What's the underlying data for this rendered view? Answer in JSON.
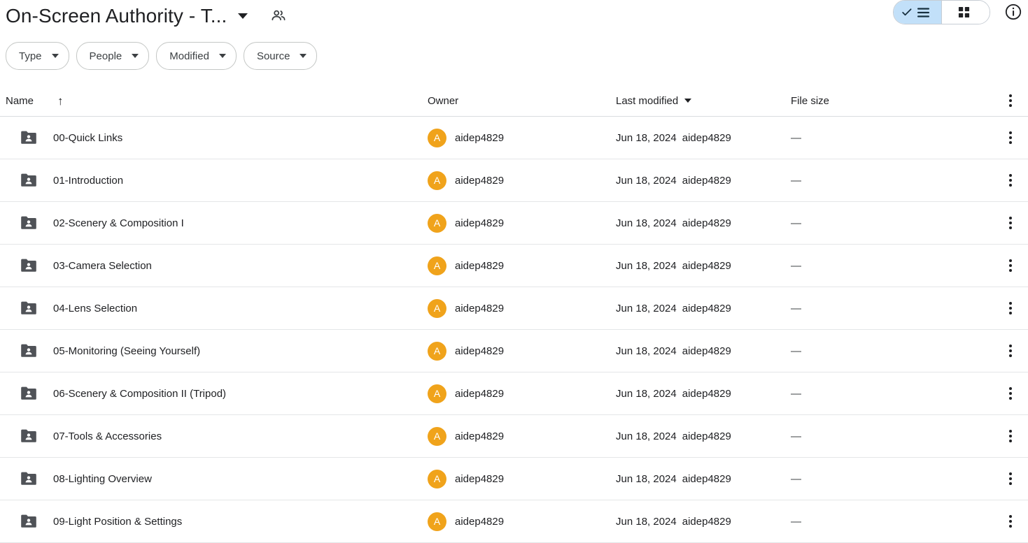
{
  "header": {
    "title": "On-Screen Authority - T...",
    "title_caret_icon": "chevron-down-icon",
    "people_icon": "people-icon",
    "view_list_label": "",
    "view_grid_label": "",
    "info_icon": "info-icon",
    "list_view_icon": "list-view-icon",
    "grid_view_icon": "grid-view-icon",
    "list_view_selected": true,
    "accent_selected_bg": "#c2e0f9"
  },
  "filters": [
    {
      "label": "Type"
    },
    {
      "label": "People"
    },
    {
      "label": "Modified"
    },
    {
      "label": "Source"
    }
  ],
  "table": {
    "columns": {
      "name": "Name",
      "sort_arrow": "↑",
      "owner": "Owner",
      "last_modified": "Last modified",
      "file_size": "File size"
    },
    "rows": [
      {
        "name": "00-Quick Links",
        "owner": "aidep4829",
        "avatar_letter": "A",
        "modified_date": "Jun 18, 2024",
        "modified_by": "aidep4829",
        "size": "—"
      },
      {
        "name": "01-Introduction",
        "owner": "aidep4829",
        "avatar_letter": "A",
        "modified_date": "Jun 18, 2024",
        "modified_by": "aidep4829",
        "size": "—"
      },
      {
        "name": "02-Scenery & Composition I",
        "owner": "aidep4829",
        "avatar_letter": "A",
        "modified_date": "Jun 18, 2024",
        "modified_by": "aidep4829",
        "size": "—"
      },
      {
        "name": "03-Camera Selection",
        "owner": "aidep4829",
        "avatar_letter": "A",
        "modified_date": "Jun 18, 2024",
        "modified_by": "aidep4829",
        "size": "—"
      },
      {
        "name": "04-Lens Selection",
        "owner": "aidep4829",
        "avatar_letter": "A",
        "modified_date": "Jun 18, 2024",
        "modified_by": "aidep4829",
        "size": "—"
      },
      {
        "name": "05-Monitoring (Seeing Yourself)",
        "owner": "aidep4829",
        "avatar_letter": "A",
        "modified_date": "Jun 18, 2024",
        "modified_by": "aidep4829",
        "size": "—"
      },
      {
        "name": "06-Scenery & Composition II (Tripod)",
        "owner": "aidep4829",
        "avatar_letter": "A",
        "modified_date": "Jun 18, 2024",
        "modified_by": "aidep4829",
        "size": "—"
      },
      {
        "name": "07-Tools & Accessories",
        "owner": "aidep4829",
        "avatar_letter": "A",
        "modified_date": "Jun 18, 2024",
        "modified_by": "aidep4829",
        "size": "—"
      },
      {
        "name": "08-Lighting Overview",
        "owner": "aidep4829",
        "avatar_letter": "A",
        "modified_date": "Jun 18, 2024",
        "modified_by": "aidep4829",
        "size": "—"
      },
      {
        "name": "09-Light Position & Settings",
        "owner": "aidep4829",
        "avatar_letter": "A",
        "modified_date": "Jun 18, 2024",
        "modified_by": "aidep4829",
        "size": "—"
      }
    ]
  },
  "colors": {
    "avatar_orange": "#f0a31b",
    "folder_gray": "#5f6368",
    "selected_blue": "#c2e0f9",
    "text_primary": "#202124"
  }
}
